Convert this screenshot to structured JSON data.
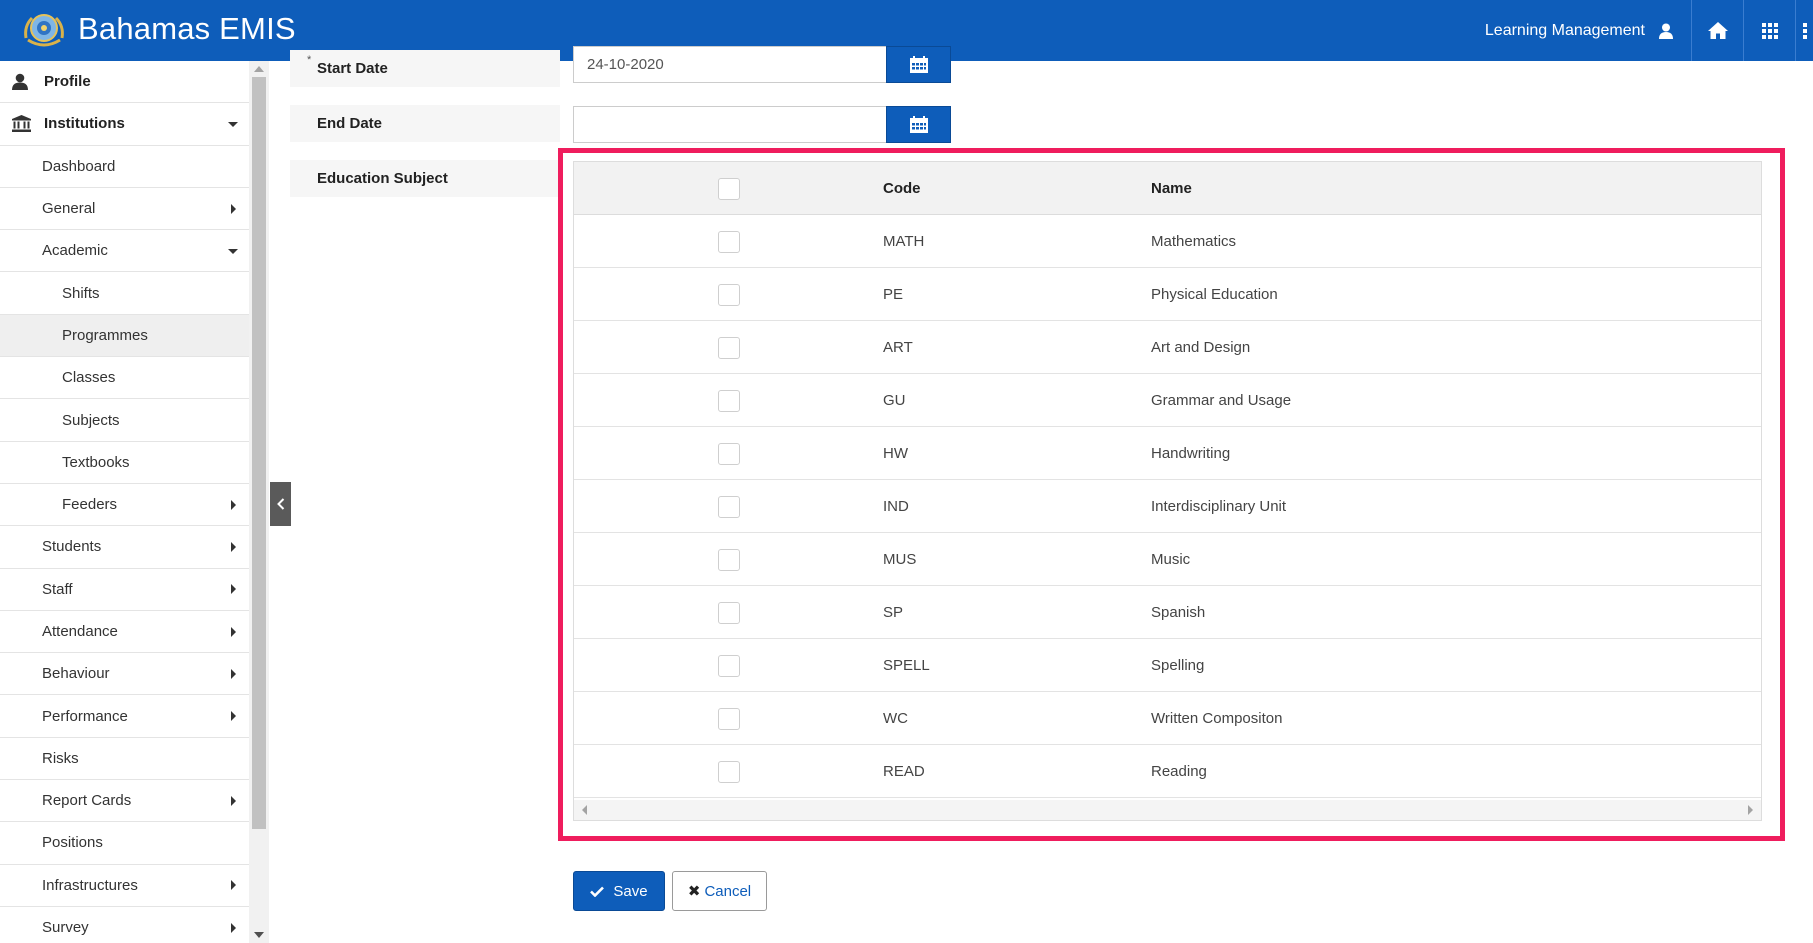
{
  "header": {
    "app_title": "Bahamas EMIS",
    "user_menu_label": "Learning Management"
  },
  "colors": {
    "header_bg": "#0e5dba",
    "primary": "#0e5dba",
    "highlight_frame": "#ef1d5d"
  },
  "sidebar": {
    "items": [
      {
        "label": "Profile",
        "icon": "user-icon",
        "level": 0
      },
      {
        "label": "Institutions",
        "icon": "institution-icon",
        "level": 0,
        "expanded": true
      },
      {
        "label": "Dashboard",
        "level": 1
      },
      {
        "label": "General",
        "level": 1,
        "has_submenu": true
      },
      {
        "label": "Academic",
        "level": 1,
        "expanded": true
      },
      {
        "label": "Shifts",
        "level": 2
      },
      {
        "label": "Programmes",
        "level": 2,
        "active": true
      },
      {
        "label": "Classes",
        "level": 2
      },
      {
        "label": "Subjects",
        "level": 2
      },
      {
        "label": "Textbooks",
        "level": 2
      },
      {
        "label": "Feeders",
        "level": 2,
        "has_submenu": true
      },
      {
        "label": "Students",
        "level": 1,
        "has_submenu": true
      },
      {
        "label": "Staff",
        "level": 1,
        "has_submenu": true
      },
      {
        "label": "Attendance",
        "level": 1,
        "has_submenu": true
      },
      {
        "label": "Behaviour",
        "level": 1,
        "has_submenu": true
      },
      {
        "label": "Performance",
        "level": 1,
        "has_submenu": true
      },
      {
        "label": "Risks",
        "level": 1
      },
      {
        "label": "Report Cards",
        "level": 1,
        "has_submenu": true
      },
      {
        "label": "Positions",
        "level": 1
      },
      {
        "label": "Infrastructures",
        "level": 1,
        "has_submenu": true
      },
      {
        "label": "Survey",
        "level": 1,
        "has_submenu": true
      }
    ]
  },
  "form": {
    "start_date": {
      "label": "Start Date",
      "required_mark": "*",
      "value": "24-10-2020"
    },
    "end_date": {
      "label": "End Date",
      "value": ""
    },
    "education_subject": {
      "label": "Education Subject"
    }
  },
  "subjects_table": {
    "columns": [
      "Code",
      "Name"
    ],
    "rows": [
      {
        "code": "MATH",
        "name": "Mathematics",
        "checked": false
      },
      {
        "code": "PE",
        "name": "Physical Education",
        "checked": false
      },
      {
        "code": "ART",
        "name": "Art and Design",
        "checked": false
      },
      {
        "code": "GU",
        "name": "Grammar and Usage",
        "checked": false
      },
      {
        "code": "HW",
        "name": "Handwriting",
        "checked": false
      },
      {
        "code": "IND",
        "name": "Interdisciplinary Unit",
        "checked": false
      },
      {
        "code": "MUS",
        "name": "Music",
        "checked": false
      },
      {
        "code": "SP",
        "name": "Spanish",
        "checked": false
      },
      {
        "code": "SPELL",
        "name": "Spelling",
        "checked": false
      },
      {
        "code": "WC",
        "name": "Written Compositon",
        "checked": false
      },
      {
        "code": "READ",
        "name": "Reading",
        "checked": false
      }
    ]
  },
  "actions": {
    "save_label": "Save",
    "cancel_label": "Cancel"
  }
}
